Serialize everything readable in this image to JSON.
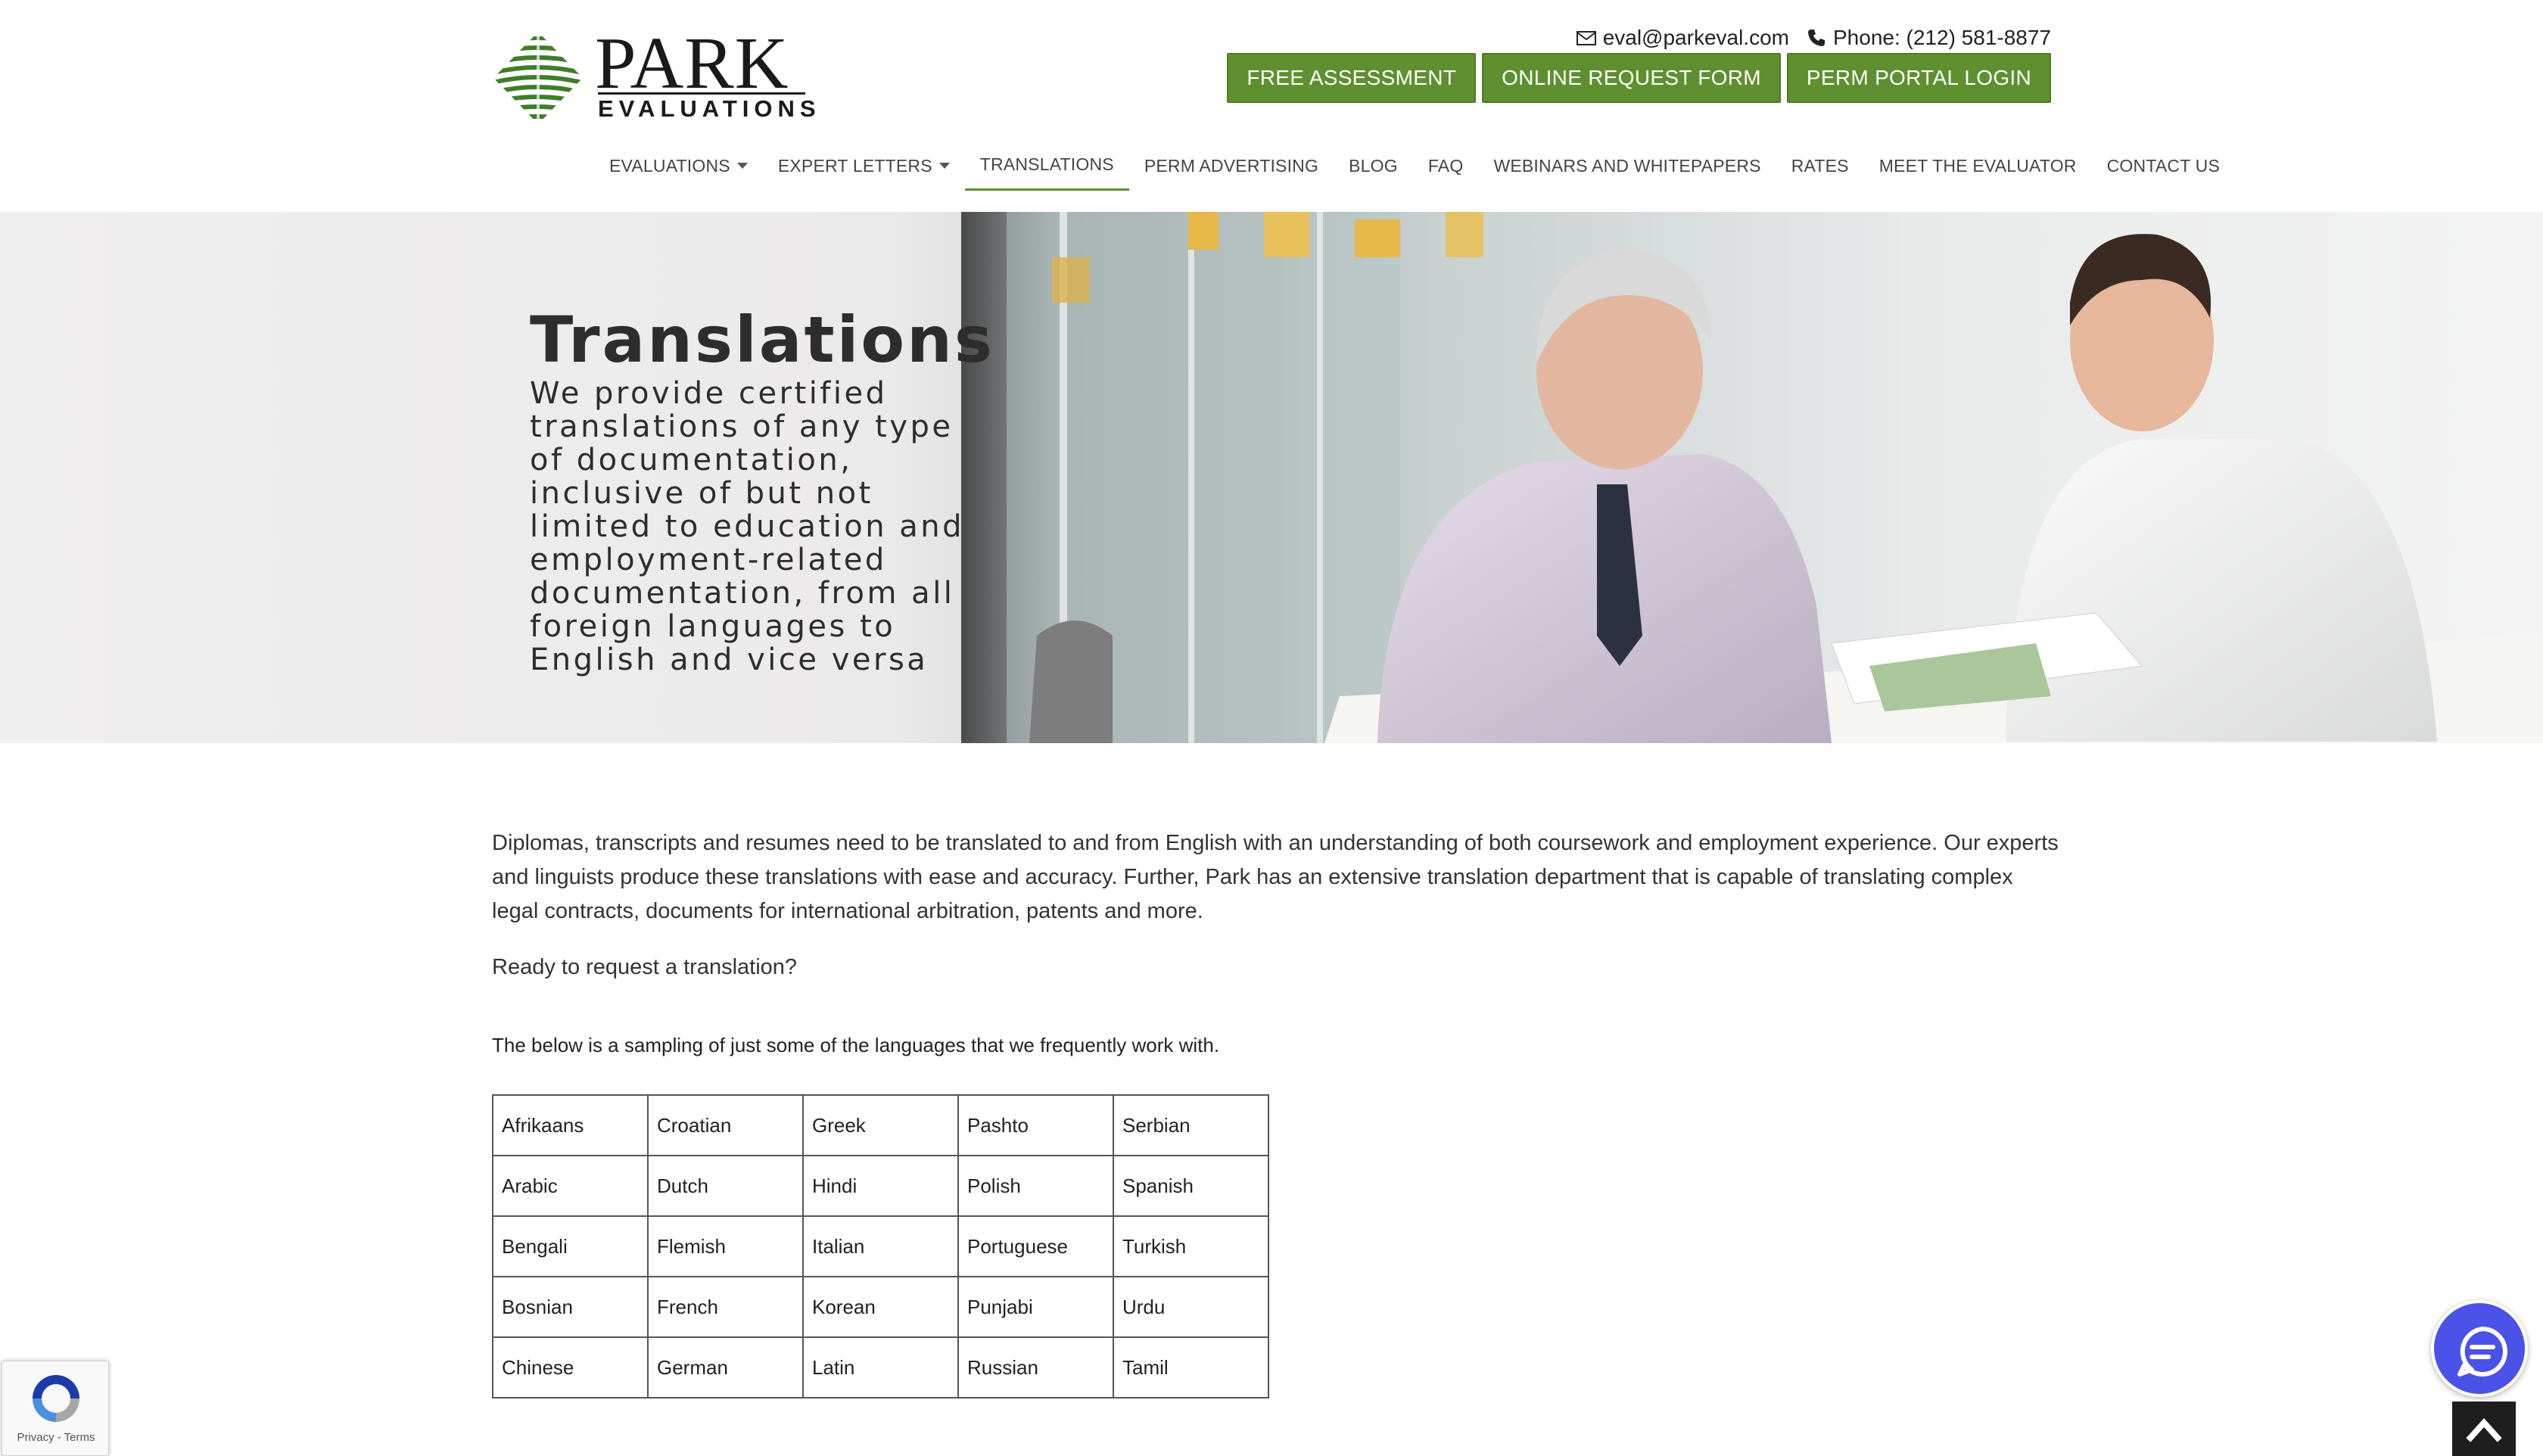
{
  "header": {
    "logo_text": "PARK",
    "logo_subtext": "EVALUATIONS",
    "email": "eval@parkeval.com",
    "phone": "Phone: (212) 581-8877",
    "buttons": {
      "free_assessment": "FREE ASSESSMENT",
      "online_request": "ONLINE REQUEST FORM",
      "perm_portal": "PERM PORTAL LOGIN"
    }
  },
  "nav": {
    "items": [
      {
        "label": "EVALUATIONS",
        "dropdown": true
      },
      {
        "label": "EXPERT LETTERS",
        "dropdown": true
      },
      {
        "label": "TRANSLATIONS",
        "active": true
      },
      {
        "label": "PERM ADVERTISING"
      },
      {
        "label": "BLOG"
      },
      {
        "label": "FAQ"
      },
      {
        "label": "WEBINARS AND WHITEPAPERS"
      },
      {
        "label": "RATES"
      },
      {
        "label": "MEET THE EVALUATOR"
      },
      {
        "label": "CONTACT US"
      }
    ]
  },
  "hero": {
    "title": "Translations",
    "subtitle": "We provide certified translations of any type of documentation, inclusive of but not limited to education and employment-related documentation, from all foreign languages to English and vice versa"
  },
  "main": {
    "intro": "Diplomas, transcripts and resumes need to be translated to and from English with an understanding of both coursework and employment experience. Our experts and linguists produce these translations with ease and accuracy. Further, Park has an extensive translation department that is capable of translating complex legal contracts, documents for international arbitration, patents and more.",
    "ready": "Ready to request a translation?",
    "sampling": "The below is a sampling of just some of the languages that we frequently work with.",
    "languages": [
      [
        "Afrikaans",
        "Croatian",
        "Greek",
        "Pashto",
        "Serbian"
      ],
      [
        "Arabic",
        "Dutch",
        "Hindi",
        "Polish",
        "Spanish"
      ],
      [
        "Bengali",
        "Flemish",
        "Italian",
        "Portuguese",
        "Turkish"
      ],
      [
        "Bosnian",
        "French",
        "Korean",
        "Punjabi",
        "Urdu"
      ],
      [
        "Chinese",
        "German",
        "Latin",
        "Russian",
        "Tamil"
      ]
    ]
  },
  "widgets": {
    "recaptcha_links": "Privacy - Terms"
  },
  "colors": {
    "brand_green": "#5f8f2f",
    "chat_blue": "#4a52e8"
  }
}
